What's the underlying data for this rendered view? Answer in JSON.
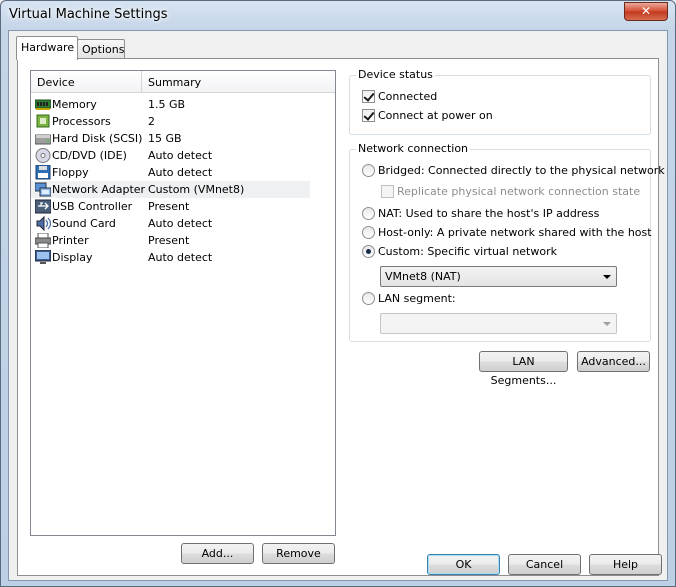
{
  "window": {
    "title": "Virtual Machine Settings",
    "close_glyph": "✕"
  },
  "tabs": [
    {
      "label": "Hardware",
      "active": true
    },
    {
      "label": "Options",
      "active": false
    }
  ],
  "device_list": {
    "columns": [
      "Device",
      "Summary"
    ],
    "rows": [
      {
        "device": "Memory",
        "summary": "1.5 GB",
        "icon": "memory-icon"
      },
      {
        "device": "Processors",
        "summary": "2",
        "icon": "processor-icon"
      },
      {
        "device": "Hard Disk (SCSI)",
        "summary": "15 GB",
        "icon": "hard-disk-icon"
      },
      {
        "device": "CD/DVD (IDE)",
        "summary": "Auto detect",
        "icon": "cd-dvd-icon"
      },
      {
        "device": "Floppy",
        "summary": "Auto detect",
        "icon": "floppy-icon"
      },
      {
        "device": "Network Adapter",
        "summary": "Custom (VMnet8)",
        "icon": "network-adapter-icon",
        "selected": true
      },
      {
        "device": "USB Controller",
        "summary": "Present",
        "icon": "usb-icon"
      },
      {
        "device": "Sound Card",
        "summary": "Auto detect",
        "icon": "sound-card-icon"
      },
      {
        "device": "Printer",
        "summary": "Present",
        "icon": "printer-icon"
      },
      {
        "device": "Display",
        "summary": "Auto detect",
        "icon": "display-icon"
      }
    ],
    "add_button": "Add...",
    "remove_button": "Remove"
  },
  "device_status": {
    "title": "Device status",
    "connected_label": "Connected",
    "connected_checked": true,
    "connect_at_power_on_label": "Connect at power on",
    "connect_at_power_on_checked": true
  },
  "network_connection": {
    "title": "Network connection",
    "bridged_label": "Bridged: Connected directly to the physical network",
    "replicate_label": "Replicate physical network connection state",
    "nat_label": "NAT: Used to share the host's IP address",
    "host_only_label": "Host-only: A private network shared with the host",
    "custom_label": "Custom: Specific virtual network",
    "custom_network_value": "VMnet8 (NAT)",
    "lan_segment_label": "LAN segment:",
    "lan_segment_value": "",
    "selected_option": "custom"
  },
  "buttons": {
    "lan_segments": "LAN Segments...",
    "advanced": "Advanced...",
    "ok": "OK",
    "cancel": "Cancel",
    "help": "Help"
  }
}
